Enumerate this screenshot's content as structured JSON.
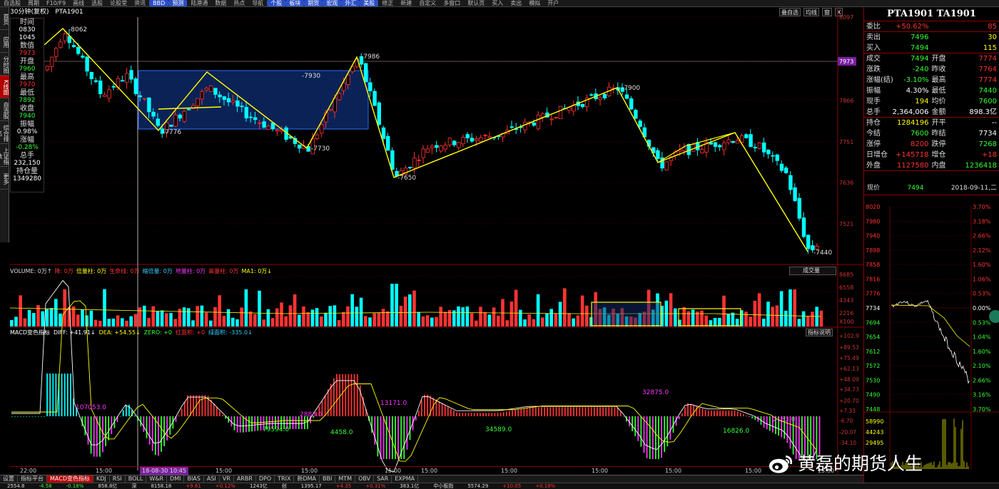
{
  "toolbar": {
    "items": [
      "自选股",
      "周期",
      "F10/F9",
      "画线",
      "选股",
      "论股堂",
      "资讯",
      "BBD",
      "预测",
      "陆港通",
      "数据",
      "热点",
      "导航",
      "个股",
      "板块",
      "期货",
      "宏观",
      "外汇",
      "美股",
      "修正",
      "新建",
      "自定义",
      "多窗口",
      "默认页",
      "买入",
      "卖出",
      "模拟",
      "开户"
    ],
    "highlight": [
      "BBD",
      "预测",
      "个股",
      "板块",
      "期货",
      "宏观",
      "外汇",
      "美股"
    ]
  },
  "side_tabs": [
    {
      "label": "首页"
    },
    {
      "label": "应用"
    },
    {
      "label": "分时图"
    },
    {
      "label": "K线图",
      "active": true
    },
    {
      "label": "自选股"
    },
    {
      "label": "综合排名"
    },
    {
      "label": "上证指数"
    },
    {
      "label": "更多"
    }
  ],
  "chart_header": {
    "period": "30分钟(复权)",
    "code": "PTA1901"
  },
  "top_right_buttons": [
    "叠自选",
    "均线",
    "窗",
    "X"
  ],
  "info_box": {
    "rows": [
      {
        "label": "时间",
        "values": [
          "0830",
          "1045"
        ],
        "color": "#ffffff"
      },
      {
        "label": "数值",
        "values": [
          "7973"
        ],
        "color": "#ff3333"
      },
      {
        "label": "开盘",
        "values": [
          "7960"
        ],
        "color": "#33ff33"
      },
      {
        "label": "最高",
        "values": [
          "7970"
        ],
        "color": "#ff3333"
      },
      {
        "label": "最低",
        "values": [
          "7892"
        ],
        "color": "#33ff33"
      },
      {
        "label": "收盘",
        "values": [
          "7940"
        ],
        "color": "#33ff33"
      },
      {
        "label": "振幅",
        "values": [
          "0.98%"
        ],
        "color": "#ffffff"
      },
      {
        "label": "涨幅",
        "values": [
          "-0.28%"
        ],
        "color": "#33ff33"
      },
      {
        "label": "总手",
        "values": [
          "232,150"
        ],
        "color": "#ffffff"
      },
      {
        "label": "持仓量",
        "values": [
          "1349280"
        ],
        "color": "#ffffff"
      }
    ]
  },
  "price_axis": {
    "labels": [
      "8097",
      "7981",
      "7866",
      "7751",
      "7636",
      "7521"
    ],
    "current": "7973"
  },
  "volume": {
    "header": [
      {
        "text": "VOLUME: 0万↑",
        "color": "#dddddd"
      },
      {
        "text": "降: 0万",
        "color": "#ff3333"
      },
      {
        "text": "倍量柱: 0万",
        "color": "#ffff00"
      },
      {
        "text": "生命线: 0万",
        "color": "#ff3333"
      },
      {
        "text": "缩倍量: 0万",
        "color": "#33ccff"
      },
      {
        "text": "地量柱: 0万",
        "color": "#ff33ff"
      },
      {
        "text": "高量柱: 0万",
        "color": "#ff3333"
      },
      {
        "text": "MA1: 0万↓",
        "color": "#ffff00"
      }
    ],
    "select": "成交量",
    "axis": [
      "8685",
      "6558",
      "4343",
      "2216",
      "X100"
    ]
  },
  "macd": {
    "header": [
      {
        "text": "MACD变色指标",
        "color": "#ffffff"
      },
      {
        "text": "DIFF: +41.91↓",
        "color": "#ffffff"
      },
      {
        "text": "DEA: +54.55↓",
        "color": "#ffff00"
      },
      {
        "text": "ZERO: +0",
        "color": "#33ff33"
      },
      {
        "text": "红面积: +0",
        "color": "#ff3333"
      },
      {
        "text": "绿面积: -335.0↓",
        "color": "#33ccff"
      }
    ],
    "button": "指标说明",
    "axis": [
      "+102.9",
      "+89.53",
      "+75.49",
      "+62.13",
      "+48.09",
      "+34.73",
      "+20.70",
      "+7.33",
      "-6.70",
      "-20.07",
      "-34.10"
    ],
    "annotations": [
      "107053.0",
      "79594.0",
      "2883.0",
      "4458.0",
      "13171.0",
      "34589.0",
      "32875.0",
      "16826.0",
      "2183.0"
    ]
  },
  "time_axis": {
    "labels": [
      {
        "text": "22:00",
        "sel": false
      },
      {
        "text": "15:00",
        "sel": false
      },
      {
        "text": "18-08-30 10:45",
        "sel": true
      },
      {
        "text": "15:00",
        "sel": false
      },
      {
        "text": "15:00",
        "sel": false
      },
      {
        "text": "15:00",
        "sel": false
      },
      {
        "text": "15:00",
        "sel": false
      },
      {
        "text": "15:00",
        "sel": false
      },
      {
        "text": "15:00",
        "sel": false
      },
      {
        "text": "15:00",
        "sel": false
      },
      {
        "text": "15:00",
        "sel": false
      },
      {
        "text": "15:00",
        "sel": false
      },
      {
        "text": "15:00",
        "sel": false
      }
    ]
  },
  "bottom_tabs": [
    {
      "label": "设置",
      "active": false
    },
    {
      "label": "指标平台",
      "active": false
    },
    {
      "label": "MACD变色指标",
      "active": true
    },
    {
      "label": "KDJ",
      "active": false
    },
    {
      "label": "RSI",
      "active": false
    },
    {
      "label": "BOLL",
      "active": false
    },
    {
      "label": "W&R",
      "active": false
    },
    {
      "label": "DMI",
      "active": false
    },
    {
      "label": "BIAS",
      "active": false
    },
    {
      "label": "ASI",
      "active": false
    },
    {
      "label": "VR",
      "active": false
    },
    {
      "label": "ARBR",
      "active": false
    },
    {
      "label": "DPO",
      "active": false
    },
    {
      "label": "TRIX",
      "active": false
    },
    {
      "label": "新DMA",
      "active": false
    },
    {
      "label": "BBI",
      "active": false
    },
    {
      "label": "MTM",
      "active": false
    },
    {
      "label": "OBV",
      "active": false
    },
    {
      "label": "SAR",
      "active": false
    },
    {
      "label": "EXPMA",
      "active": false
    }
  ],
  "status_bar": [
    "2554.8",
    "-4.58",
    "-0.18%",
    "858.8亿",
    "深",
    "8158.18",
    "+9.61",
    "+0.12%",
    "1243亿",
    "创",
    "1395.17",
    "+4.35",
    "+0.31%",
    "383.1亿",
    "中小板指",
    "5574.29",
    "+10.05",
    "+0.18%"
  ],
  "right_panel": {
    "title": "PTA1901 TA1901",
    "rows": [
      {
        "cells": [
          {
            "label": "委比",
            "value": "+50.62%",
            "color": "#ff3333"
          },
          {
            "label": "",
            "value": "85",
            "color": "#ff3333"
          }
        ],
        "sep": true
      },
      {
        "cells": [
          {
            "label": "卖出",
            "value": "7496",
            "color": "#33ff33"
          },
          {
            "label": "",
            "value": "30",
            "color": "#ffff00"
          }
        ]
      },
      {
        "cells": [
          {
            "label": "买入",
            "value": "7494",
            "color": "#33ff33"
          },
          {
            "label": "",
            "value": "115",
            "color": "#ffff00"
          }
        ],
        "sep": true
      },
      {
        "cells": [
          {
            "label": "成交",
            "value": "7494",
            "color": "#33ff33"
          },
          {
            "label": "开盘",
            "value": "7774",
            "color": "#ff3333"
          }
        ]
      },
      {
        "cells": [
          {
            "label": "涨跌",
            "value": "-240",
            "color": "#33ff33"
          },
          {
            "label": "昨收",
            "value": "7764",
            "color": "#ff3333"
          }
        ]
      },
      {
        "cells": [
          {
            "label": "涨幅(结)",
            "value": "-3.10%",
            "color": "#33ff33"
          },
          {
            "label": "最高",
            "value": "7774",
            "color": "#ff3333"
          }
        ]
      },
      {
        "cells": [
          {
            "label": "振幅",
            "value": "4.30%",
            "color": "#ffffff"
          },
          {
            "label": "最低",
            "value": "7440",
            "color": "#33ff33"
          }
        ]
      },
      {
        "cells": [
          {
            "label": "现手",
            "value": "194",
            "color": "#ffff00"
          },
          {
            "label": "均价",
            "value": "7600",
            "color": "#33ff33"
          }
        ]
      },
      {
        "cells": [
          {
            "label": "总手",
            "value": "2,364,006",
            "color": "#ffffff"
          },
          {
            "label": "金额",
            "value": "898.3亿",
            "color": "#ffffff"
          }
        ],
        "sep": true
      },
      {
        "cells": [
          {
            "label": "持仓",
            "value": "1284196",
            "color": "#ffff00"
          },
          {
            "label": "开平",
            "value": "--",
            "color": "#ffffff"
          }
        ]
      },
      {
        "cells": [
          {
            "label": "今结",
            "value": "7600",
            "color": "#33ff33"
          },
          {
            "label": "昨结",
            "value": "7734",
            "color": "#ffffff"
          }
        ]
      },
      {
        "cells": [
          {
            "label": "涨停",
            "value": "8200",
            "color": "#ff3333"
          },
          {
            "label": "跌停",
            "value": "7268",
            "color": "#33ff33"
          }
        ]
      },
      {
        "cells": [
          {
            "label": "日增仓",
            "value": "+145718",
            "color": "#ff3333"
          },
          {
            "label": "增仓",
            "value": "+18",
            "color": "#ff3333"
          }
        ]
      },
      {
        "cells": [
          {
            "label": "外盘",
            "value": "1127580",
            "color": "#ff3333"
          },
          {
            "label": "内盘",
            "value": "1236418",
            "color": "#33ff33"
          }
        ],
        "sep": true
      }
    ],
    "current": {
      "label": "现价",
      "value": "7494",
      "date": "2018-09-11,二"
    },
    "mini_axis_left": [
      "8020",
      "7980",
      "7940",
      "7898",
      "7858",
      "7816",
      "7776",
      "7734",
      "7694",
      "7654",
      "7612",
      "7572",
      "7530",
      "7490",
      "7448",
      "58990",
      "44243",
      "29495"
    ],
    "mini_axis_right": [
      "3.70%",
      "3.18%",
      "2.66%",
      "2.12%",
      "1.60%",
      "1.06%",
      "0.53%",
      "0.00%",
      "0.53%",
      "1.04%",
      "1.60%",
      "2.10%",
      "2.66%",
      "3.16%",
      "3.70%"
    ]
  },
  "watermark": {
    "text": "黄磊的期货人生"
  },
  "colors": {
    "up": "#ff3333",
    "down": "#00ffff",
    "yellow": "#ffff00",
    "grid": "#8b0000"
  }
}
